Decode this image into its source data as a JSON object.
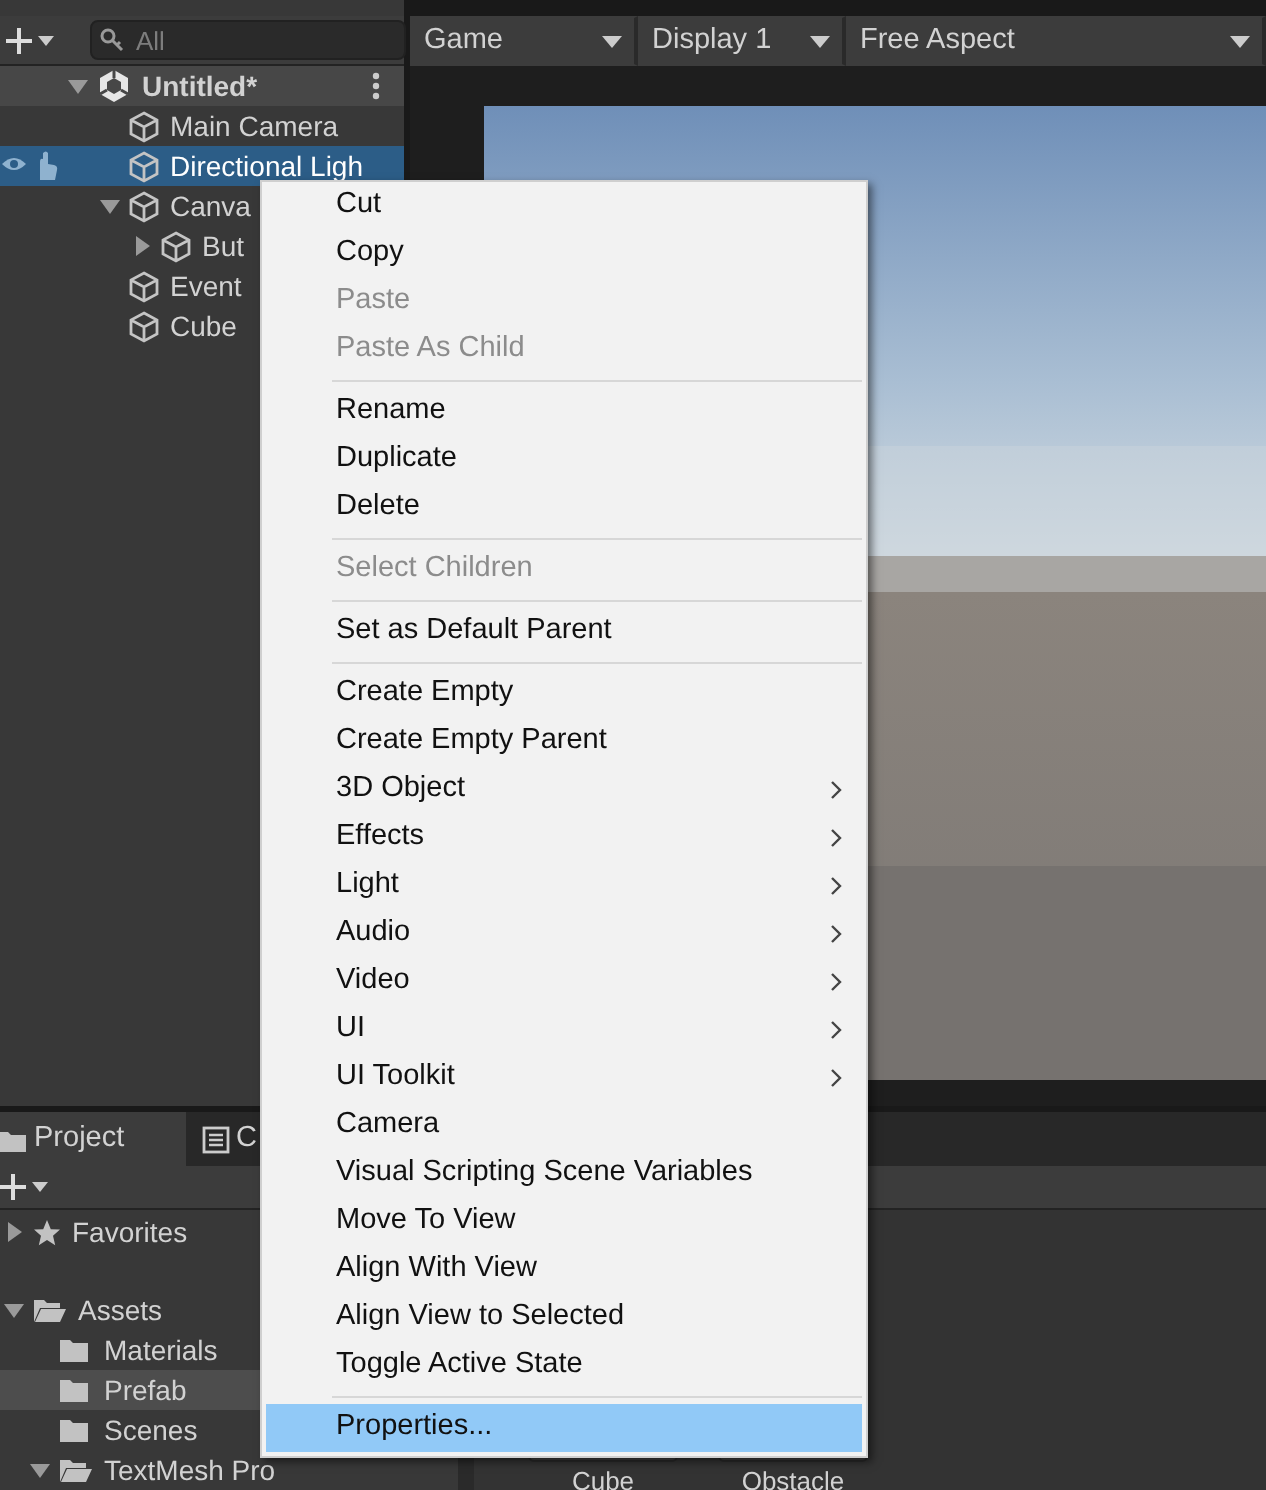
{
  "hierarchy": {
    "search": {
      "placeholder": "All"
    },
    "items": [
      {
        "label": "Untitled*",
        "kind": "scene",
        "expanded": true,
        "selected": false,
        "children": [
          {
            "label": "Main Camera",
            "kind": "object",
            "selected": false
          },
          {
            "label": "Directional Ligh",
            "kind": "object",
            "selected": true
          },
          {
            "label": "Canva",
            "kind": "object",
            "expanded": true,
            "selected": false,
            "children": [
              {
                "label": "But",
                "kind": "object",
                "expanded": false,
                "selected": false
              }
            ]
          },
          {
            "label": "Event",
            "kind": "object",
            "selected": false
          },
          {
            "label": "Cube",
            "kind": "object",
            "selected": false
          }
        ]
      }
    ]
  },
  "game_toolbar": {
    "view": "Game",
    "display": "Display 1",
    "aspect": "Free Aspect"
  },
  "project": {
    "tabs": [
      {
        "label": "Project",
        "selected": true
      },
      {
        "label": "C",
        "selected": false
      }
    ],
    "tree": [
      {
        "label": "Favorites",
        "kind": "favorites",
        "expanded": false,
        "selected": false
      },
      {
        "label": "Assets",
        "kind": "folder",
        "expanded": true,
        "selected": false,
        "children": [
          {
            "label": "Materials",
            "kind": "folder",
            "selected": false
          },
          {
            "label": "Prefab",
            "kind": "folder",
            "selected": true
          },
          {
            "label": "Scenes",
            "kind": "folder",
            "selected": false
          },
          {
            "label": "TextMesh Pro",
            "kind": "folder",
            "expanded": true,
            "selected": false
          }
        ]
      }
    ],
    "assets": [
      {
        "label": "Cube"
      },
      {
        "label": "Obstacle"
      }
    ]
  },
  "context_menu": {
    "items": [
      {
        "kind": "item",
        "label": "Cut",
        "disabled": false,
        "submenu": false,
        "selected": false
      },
      {
        "kind": "item",
        "label": "Copy",
        "disabled": false,
        "submenu": false,
        "selected": false
      },
      {
        "kind": "item",
        "label": "Paste",
        "disabled": true,
        "submenu": false,
        "selected": false
      },
      {
        "kind": "item",
        "label": "Paste As Child",
        "disabled": true,
        "submenu": false,
        "selected": false
      },
      {
        "kind": "separator"
      },
      {
        "kind": "item",
        "label": "Rename",
        "disabled": false,
        "submenu": false,
        "selected": false
      },
      {
        "kind": "item",
        "label": "Duplicate",
        "disabled": false,
        "submenu": false,
        "selected": false
      },
      {
        "kind": "item",
        "label": "Delete",
        "disabled": false,
        "submenu": false,
        "selected": false
      },
      {
        "kind": "separator"
      },
      {
        "kind": "item",
        "label": "Select Children",
        "disabled": true,
        "submenu": false,
        "selected": false
      },
      {
        "kind": "separator"
      },
      {
        "kind": "item",
        "label": "Set as Default Parent",
        "disabled": false,
        "submenu": false,
        "selected": false
      },
      {
        "kind": "separator"
      },
      {
        "kind": "item",
        "label": "Create Empty",
        "disabled": false,
        "submenu": false,
        "selected": false
      },
      {
        "kind": "item",
        "label": "Create Empty Parent",
        "disabled": false,
        "submenu": false,
        "selected": false
      },
      {
        "kind": "item",
        "label": "3D Object",
        "disabled": false,
        "submenu": true,
        "selected": false
      },
      {
        "kind": "item",
        "label": "Effects",
        "disabled": false,
        "submenu": true,
        "selected": false
      },
      {
        "kind": "item",
        "label": "Light",
        "disabled": false,
        "submenu": true,
        "selected": false
      },
      {
        "kind": "item",
        "label": "Audio",
        "disabled": false,
        "submenu": true,
        "selected": false
      },
      {
        "kind": "item",
        "label": "Video",
        "disabled": false,
        "submenu": true,
        "selected": false
      },
      {
        "kind": "item",
        "label": "UI",
        "disabled": false,
        "submenu": true,
        "selected": false
      },
      {
        "kind": "item",
        "label": "UI Toolkit",
        "disabled": false,
        "submenu": true,
        "selected": false
      },
      {
        "kind": "item",
        "label": "Camera",
        "disabled": false,
        "submenu": false,
        "selected": false
      },
      {
        "kind": "item",
        "label": "Visual Scripting Scene Variables",
        "disabled": false,
        "submenu": false,
        "selected": false
      },
      {
        "kind": "item",
        "label": "Move To View",
        "disabled": false,
        "submenu": false,
        "selected": false
      },
      {
        "kind": "item",
        "label": "Align With View",
        "disabled": false,
        "submenu": false,
        "selected": false
      },
      {
        "kind": "item",
        "label": "Align View to Selected",
        "disabled": false,
        "submenu": false,
        "selected": false
      },
      {
        "kind": "item",
        "label": "Toggle Active State",
        "disabled": false,
        "submenu": false,
        "selected": false
      },
      {
        "kind": "separator"
      },
      {
        "kind": "item",
        "label": "Properties...",
        "disabled": false,
        "submenu": false,
        "selected": true
      }
    ]
  }
}
